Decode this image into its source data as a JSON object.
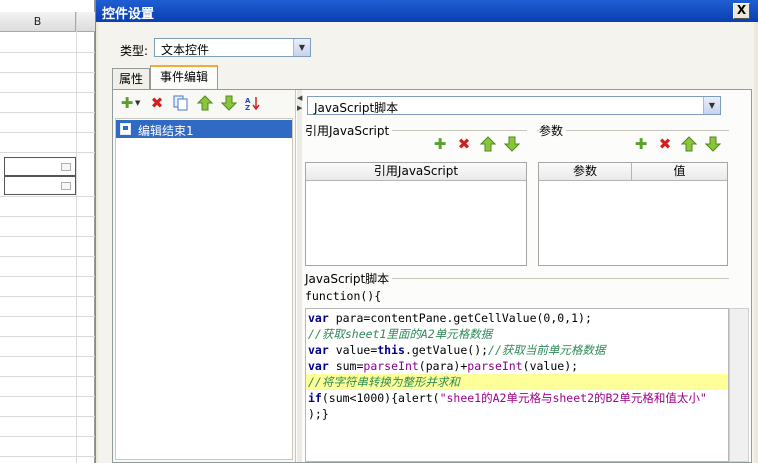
{
  "sheet": {
    "column_header": "B"
  },
  "dialog": {
    "title": "控件设置",
    "close_symbol": "X",
    "type_label": "类型:",
    "type_value": "文本控件",
    "tabs": [
      "属性",
      "事件编辑"
    ],
    "active_tab": "事件编辑",
    "event_list": [
      "编辑结束1"
    ],
    "script_type": "JavaScript脚本",
    "ref_js_group": "引用JavaScript",
    "params_group": "参数",
    "ref_js_column": "引用JavaScript",
    "param_columns": [
      "参数",
      "值"
    ],
    "script_group": "JavaScript脚本",
    "function_header": "function(){",
    "code_lines": [
      "var para=contentPane.getCellValue(0,0,1);",
      "//获取sheet1里面的A2单元格数据",
      "var value=this.getValue();//获取当前单元格数据",
      "var sum=parseInt(para)+parseInt(value);",
      "//将字符串转换为整形并求和",
      "if(sum<1000){alert(\"shee1的A2单元格与sheet2的B2单元格和值太小\"",
      ");}"
    ],
    "highlighted_line": 4
  },
  "icons": {
    "add": "plus-icon",
    "delete": "delete-icon",
    "copy": "copy-icon",
    "up": "arrow-up-icon",
    "down": "arrow-down-icon",
    "sort": "sort-icon"
  },
  "colors": {
    "titlebar": "#0a3fb0",
    "selection": "#316ac5",
    "add_icon": "#5aa02c",
    "delete_icon": "#d02020",
    "arrow_icon": "#7db838",
    "highlight_line": "#ffff99",
    "keyword": "#00008b",
    "comment": "#2e8b57"
  }
}
